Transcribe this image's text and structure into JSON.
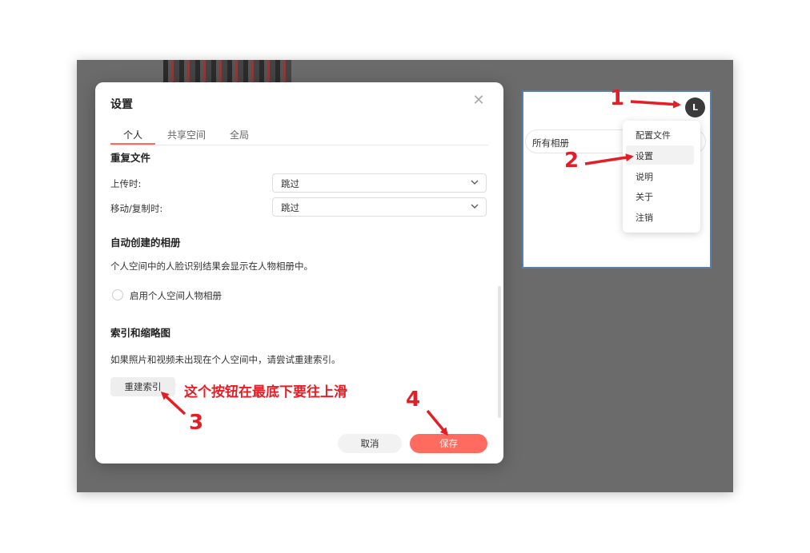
{
  "dialog": {
    "title": "设置",
    "close_icon": "close-icon",
    "tabs": [
      {
        "label": "个人",
        "active": true
      },
      {
        "label": "共享空间",
        "active": false
      },
      {
        "label": "全局",
        "active": false
      }
    ],
    "duplicate_files": {
      "title": "重复文件",
      "upload_label": "上传时:",
      "upload_value": "跳过",
      "move_copy_label": "移动/复制时:",
      "move_copy_value": "跳过"
    },
    "auto_albums": {
      "title": "自动创建的相册",
      "description": "个人空间中的人脸识别结果会显示在人物相册中。",
      "toggle_label": "启用个人空间人物相册",
      "toggle_checked": false
    },
    "index": {
      "title": "索引和缩略图",
      "description": "如果照片和视频未出现在个人空间中，请尝试重建索引。",
      "rebuild_button": "重建索引"
    },
    "cancel_button": "取消",
    "save_button": "保存"
  },
  "side_panel": {
    "album_selector": "所有相册",
    "avatar_letter": "L",
    "menu": [
      "配置文件",
      "设置",
      "说明",
      "关于",
      "注销"
    ],
    "highlighted_menu_item": "设置"
  },
  "annotations": {
    "numbers": [
      "1",
      "2",
      "3",
      "4"
    ],
    "note": "这个按钮在最底下要往上滑",
    "color": "#e41e26"
  },
  "colors": {
    "accent": "#ff6b5e",
    "overlay": "#6b6b6b",
    "panel_border": "#5b7fa8"
  }
}
